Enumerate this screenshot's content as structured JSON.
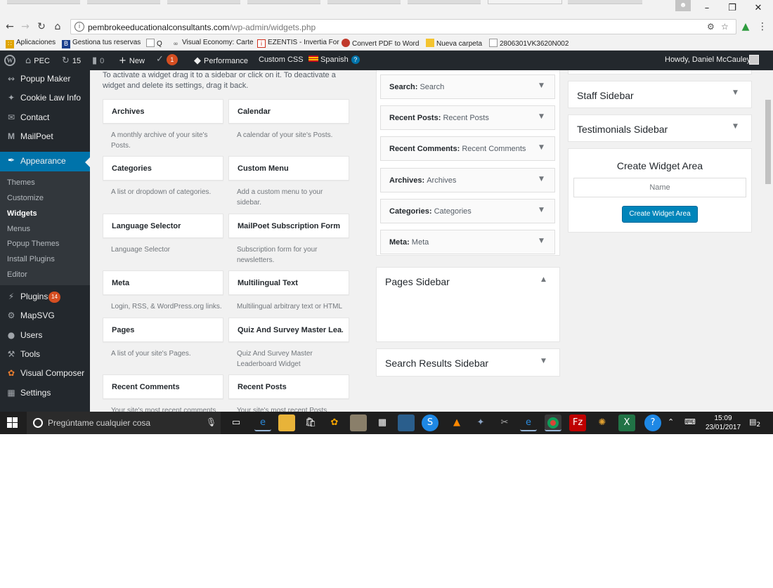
{
  "browser": {
    "url_host": "pembrokeeducationalconsultants.com",
    "url_path": "/wp-admin/widgets.php",
    "bookmarks": [
      {
        "label": "Aplicaciones",
        "icon": "apps-grid-icon",
        "color": "#e0a400"
      },
      {
        "label": "Gestiona tus reservas",
        "icon": "booking-icon",
        "color": "#1a3e8c"
      },
      {
        "label": "Q",
        "icon": "page-icon",
        "color": "#999999"
      },
      {
        "label": "Visual Economy: Carte",
        "icon": "visual-economy-icon",
        "color": "#555555"
      },
      {
        "label": "EZENTIS - Invertia For",
        "icon": "invertia-icon",
        "color": "#d0301e"
      },
      {
        "label": "Convert PDF to Word",
        "icon": "pdf-convert-icon",
        "color": "#c0392b"
      },
      {
        "label": "Nueva carpeta",
        "icon": "folder-icon",
        "color": "#f4c430"
      },
      {
        "label": "2806301VK3620N002",
        "icon": "page-icon",
        "color": "#999999"
      }
    ]
  },
  "adminbar": {
    "site_name": "PEC",
    "updates_count": "15",
    "comments_count": "0",
    "new_label": "New",
    "yoast_badge": "1",
    "performance_label": "Performance",
    "custom_css_label": "Custom CSS",
    "language_label": "Spanish",
    "howdy": "Howdy, Daniel McCauley"
  },
  "sidemenu": {
    "items": [
      {
        "label": "Popup Maker",
        "icon": "popup-maker-icon"
      },
      {
        "label": "Cookie Law Info",
        "icon": "pin-icon"
      },
      {
        "label": "Contact",
        "icon": "mail-icon"
      },
      {
        "label": "MailPoet",
        "icon": "mailpoet-icon"
      },
      {
        "label": "Appearance",
        "icon": "paintbrush-icon"
      },
      {
        "label": "Plugins",
        "icon": "plug-icon",
        "badge": "14"
      },
      {
        "label": "MapSVG",
        "icon": "gear-icon"
      },
      {
        "label": "Users",
        "icon": "user-icon"
      },
      {
        "label": "Tools",
        "icon": "wrench-icon"
      },
      {
        "label": "Visual Composer",
        "icon": "visual-composer-icon"
      },
      {
        "label": "Settings",
        "icon": "settings-icon"
      }
    ],
    "appearance_submenu": [
      "Themes",
      "Customize",
      "Widgets",
      "Menus",
      "Popup Themes",
      "Install Plugins",
      "Editor"
    ],
    "current_submenu": "Widgets"
  },
  "available_widgets": {
    "intro": "To activate a widget drag it to a sidebar or click on it. To deactivate a widget and delete its settings, drag it back.",
    "items": [
      {
        "title": "Archives",
        "desc": "A monthly archive of your site's Posts."
      },
      {
        "title": "Calendar",
        "desc": "A calendar of your site's Posts."
      },
      {
        "title": "Categories",
        "desc": "A list or dropdown of categories."
      },
      {
        "title": "Custom Menu",
        "desc": "Add a custom menu to your sidebar."
      },
      {
        "title": "Language Selector",
        "desc": "Language Selector"
      },
      {
        "title": "MailPoet Subscription Form",
        "desc": "Subscription form for your newsletters."
      },
      {
        "title": "Meta",
        "desc": "Login, RSS, & WordPress.org links."
      },
      {
        "title": "Multilingual Text",
        "desc": "Multilingual arbitrary text or HTML"
      },
      {
        "title": "Pages",
        "desc": "A list of your site's Pages."
      },
      {
        "title": "Quiz And Survey Master Lea...",
        "desc": "Quiz And Survey Master Leaderboard Widget"
      },
      {
        "title": "Recent Comments",
        "desc": "Your site's most recent comments."
      },
      {
        "title": "Recent Posts",
        "desc": "Your site's most recent Posts."
      }
    ]
  },
  "main_sidebar_widgets": [
    {
      "type": "Search",
      "title": "Search"
    },
    {
      "type": "Recent Posts",
      "title": "Recent Posts"
    },
    {
      "type": "Recent Comments",
      "title": "Recent Comments"
    },
    {
      "type": "Archives",
      "title": "Archives"
    },
    {
      "type": "Categories",
      "title": "Categories"
    },
    {
      "type": "Meta",
      "title": "Meta"
    }
  ],
  "sidebars": {
    "pages": "Pages Sidebar",
    "search_results": "Search Results Sidebar",
    "staff": "Staff Sidebar",
    "testimonials": "Testimonials Sidebar"
  },
  "create_widget_area": {
    "title": "Create Widget Area",
    "placeholder": "Name",
    "button": "Create Widget Area"
  },
  "taskbar": {
    "search_placeholder": "Pregúntame cualquier cosa",
    "time": "15:09",
    "date": "23/01/2017",
    "notifications": "2"
  },
  "colors": {
    "admin_dark": "#23282d",
    "admin_blue": "#0073aa",
    "button_blue": "#0085ba",
    "badge_orange": "#d54e21",
    "content_bg": "#f1f1f1"
  }
}
